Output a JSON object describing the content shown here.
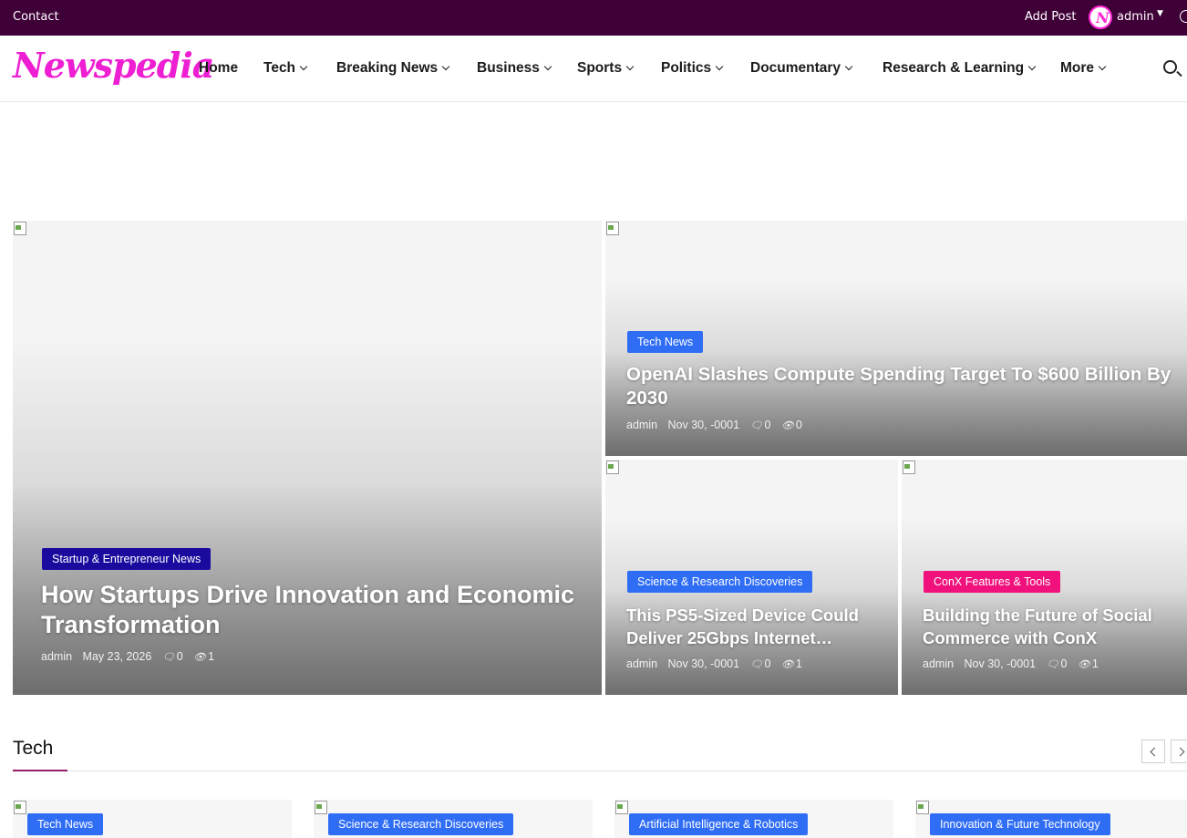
{
  "topbar": {
    "contact": "Contact",
    "add_post": "Add Post",
    "user": "admin",
    "avatar_letter": "N"
  },
  "header": {
    "logo": "Newspedia",
    "nav": [
      {
        "label": "Home",
        "has_dropdown": false
      },
      {
        "label": "Tech",
        "has_dropdown": true
      },
      {
        "label": "Breaking News",
        "has_dropdown": true
      },
      {
        "label": "Business",
        "has_dropdown": true
      },
      {
        "label": "Sports",
        "has_dropdown": true
      },
      {
        "label": "Politics",
        "has_dropdown": true
      },
      {
        "label": "Documentary",
        "has_dropdown": true
      },
      {
        "label": "Research & Learning",
        "has_dropdown": true
      },
      {
        "label": "More",
        "has_dropdown": true
      }
    ]
  },
  "hero": {
    "main": {
      "category": "Startup & Entrepreneur News",
      "category_color": "#1a0b9e",
      "title": "How Startups Drive Innovation and Economic Transformation",
      "author": "admin",
      "date": "May 23, 2026",
      "comments": "0",
      "views": "1"
    },
    "top_right": {
      "category": "Tech News",
      "category_color": "#2f6df5",
      "title": "OpenAI Slashes Compute Spending Target To $600 Billion By 2030",
      "author": "admin",
      "date": "Nov 30, -0001",
      "comments": "0",
      "views": "0"
    },
    "bottom_left": {
      "category": "Science & Research Discoveries",
      "category_color": "#2f6df5",
      "title": "This PS5-Sized Device Could Deliver 25Gbps Internet…",
      "author": "admin",
      "date": "Nov 30, -0001",
      "comments": "0",
      "views": "1"
    },
    "bottom_right": {
      "category": "ConX Features & Tools",
      "category_color": "#f0117c",
      "title": "Building the Future of Social Commerce with ConX",
      "author": "admin",
      "date": "Nov 30, -0001",
      "comments": "0",
      "views": "1"
    }
  },
  "tech_section": {
    "title": "Tech",
    "cards": [
      {
        "category": "Tech News"
      },
      {
        "category": "Science & Research Discoveries"
      },
      {
        "category": "Artificial Intelligence & Robotics"
      },
      {
        "category": "Innovation & Future Technology"
      }
    ],
    "badge_color": "#2f6df5"
  },
  "icons": {
    "comment": "comment-icon",
    "views": "eye-icon",
    "search": "search-icon",
    "clock": "clock-icon"
  }
}
